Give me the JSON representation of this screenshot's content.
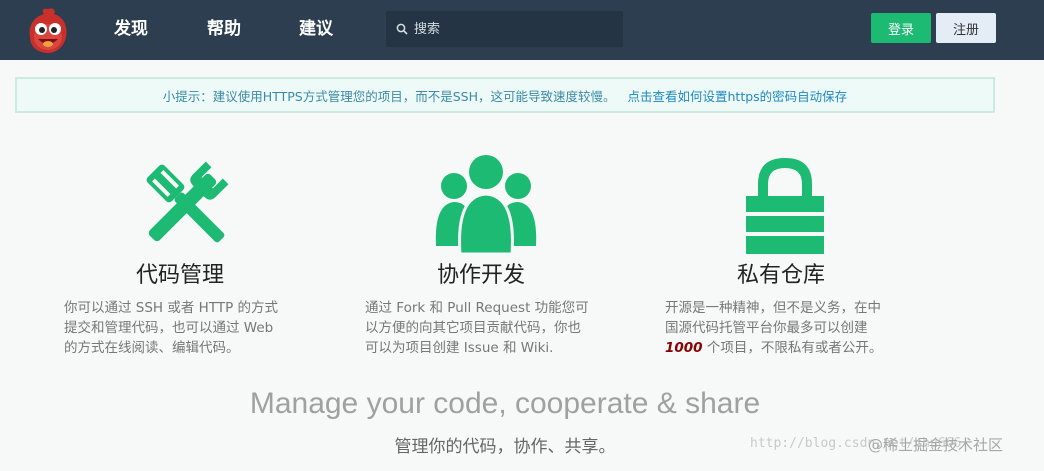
{
  "nav": {
    "links": [
      "发现",
      "帮助",
      "建议"
    ],
    "search_placeholder": "搜索",
    "login_label": "登录",
    "register_label": "注册"
  },
  "tip": {
    "text": "小提示：建议使用HTTPS方式管理您的项目，而不是SSH，这可能导致速度较慢。",
    "link": "点击查看如何设置https的密码自动保存"
  },
  "features": [
    {
      "icon": "tools-icon",
      "title": "代码管理",
      "desc_lines": [
        "你可以通过 SSH 或者 HTTP 的方式",
        "提交和管理代码，也可以通过 Web",
        "的方式在线阅读、编辑代码。"
      ]
    },
    {
      "icon": "team-icon",
      "title": "协作开发",
      "desc_lines": [
        "通过 Fork 和 Pull Request 功能您可",
        "以方便的向其它项目贡献代码，你也",
        "可以为项目创建 Issue 和 Wiki."
      ]
    },
    {
      "icon": "lock-icon",
      "title": "私有仓库",
      "desc_lines": [
        "开源是一种精神，但不是义务，在中",
        "国源代码托管平台你最多可以创建"
      ],
      "desc_emph": "1000",
      "desc_tail": " 个项目，不限私有或者公开。"
    }
  ],
  "slogan": "Manage your code, cooperate & share",
  "slogan_sub": "管理你的代码，协作、共享。",
  "watermark": {
    "url": "http://blog.csdn.net/chu666",
    "badge": "@稀土掘金技术社区"
  },
  "colors": {
    "navbar": "#2d3e50",
    "accent": "#1dba73",
    "icon": "#1dba73"
  }
}
